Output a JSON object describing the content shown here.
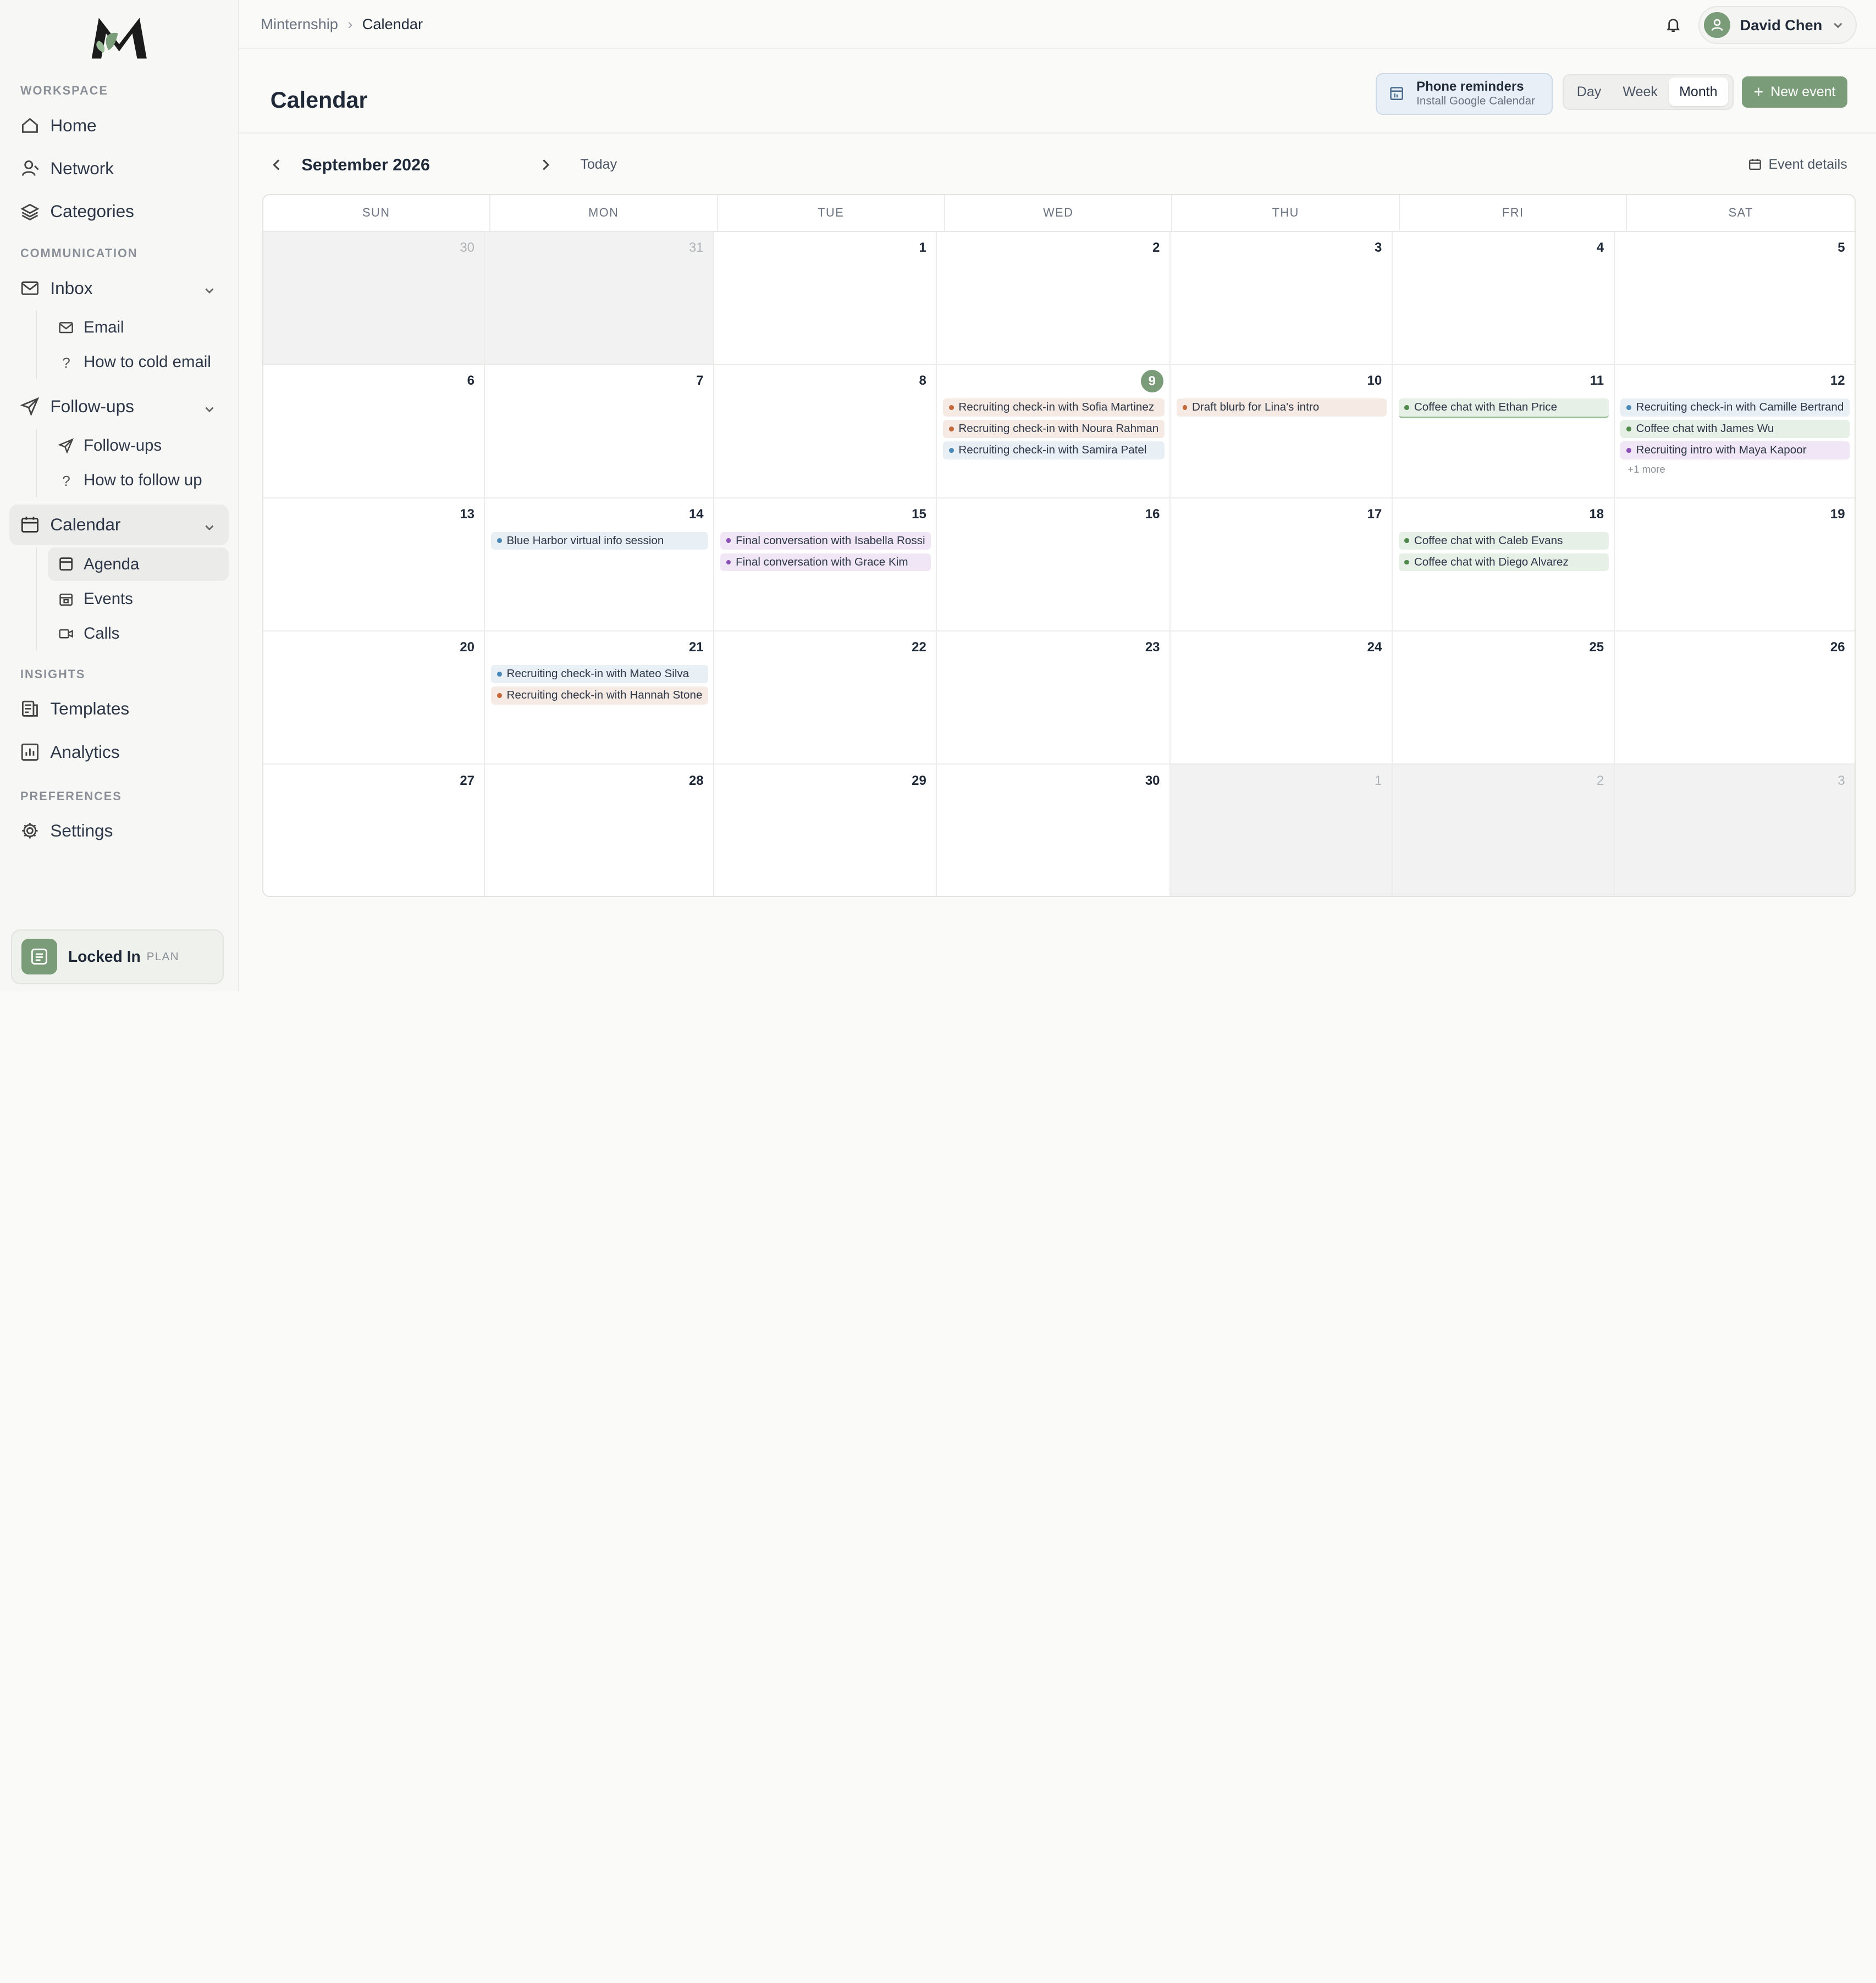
{
  "sidebar": {
    "sections": {
      "workspace": "WORKSPACE",
      "communication": "COMMUNICATION",
      "insights": "INSIGHTS",
      "preferences": "PREFERENCES"
    },
    "home": "Home",
    "network": "Network",
    "categories": "Categories",
    "inbox": "Inbox",
    "email": "Email",
    "how_to_cold_email": "How to cold email",
    "followups": "Follow-ups",
    "followups_sub": "Follow-ups",
    "how_to_follow_up": "How to follow up",
    "calendar": "Calendar",
    "agenda": "Agenda",
    "events": "Events",
    "calls": "Calls",
    "templates": "Templates",
    "analytics": "Analytics",
    "settings": "Settings",
    "plan": {
      "name": "Locked In",
      "tag": "PLAN"
    }
  },
  "topbar": {
    "breadcrumb_root": "Minternship",
    "breadcrumb_current": "Calendar",
    "user_name": "David Chen"
  },
  "header": {
    "title": "Calendar",
    "phone_reminders_title": "Phone reminders",
    "phone_reminders_sub": "Install Google Calendar",
    "views": [
      "Day",
      "Week",
      "Month"
    ],
    "active_view": "Month",
    "new_event": "New event"
  },
  "calendar_nav": {
    "month_label": "September 2026",
    "today": "Today",
    "event_details": "Event details"
  },
  "calendar": {
    "weekdays": [
      "SUN",
      "MON",
      "TUE",
      "WED",
      "THU",
      "FRI",
      "SAT"
    ],
    "today_date": "9",
    "weeks": [
      [
        {
          "day": "30",
          "out": true,
          "events": []
        },
        {
          "day": "31",
          "out": true,
          "events": []
        },
        {
          "day": "1",
          "events": []
        },
        {
          "day": "2",
          "events": []
        },
        {
          "day": "3",
          "events": []
        },
        {
          "day": "4",
          "events": []
        },
        {
          "day": "5",
          "events": []
        }
      ],
      [
        {
          "day": "6",
          "events": []
        },
        {
          "day": "7",
          "events": []
        },
        {
          "day": "8",
          "events": []
        },
        {
          "day": "9",
          "today": true,
          "events": [
            {
              "title": "Recruiting check-in with Sofia Martinez",
              "color": "orange"
            },
            {
              "title": "Recruiting check-in with Noura Rahman",
              "color": "orange"
            },
            {
              "title": "Recruiting check-in with Samira Patel",
              "color": "blue"
            }
          ]
        },
        {
          "day": "10",
          "events": [
            {
              "title": "Draft blurb for Lina's intro",
              "color": "orange"
            }
          ]
        },
        {
          "day": "11",
          "events": [
            {
              "title": "Coffee chat with Ethan Price",
              "color": "green-b"
            }
          ]
        },
        {
          "day": "12",
          "events": [
            {
              "title": "Recruiting check-in with Camille Bertrand",
              "color": "blue"
            },
            {
              "title": "Coffee chat with James Wu",
              "color": "green"
            },
            {
              "title": "Recruiting intro with Maya Kapoor",
              "color": "purple"
            }
          ],
          "more": "+1 more"
        }
      ],
      [
        {
          "day": "13",
          "events": []
        },
        {
          "day": "14",
          "events": [
            {
              "title": "Blue Harbor virtual info session",
              "color": "blue"
            }
          ]
        },
        {
          "day": "15",
          "events": [
            {
              "title": "Final conversation with Isabella Rossi",
              "color": "purple"
            },
            {
              "title": "Final conversation with Grace Kim",
              "color": "purple"
            }
          ]
        },
        {
          "day": "16",
          "events": []
        },
        {
          "day": "17",
          "events": []
        },
        {
          "day": "18",
          "events": [
            {
              "title": "Coffee chat with Caleb Evans",
              "color": "green"
            },
            {
              "title": "Coffee chat with Diego Alvarez",
              "color": "green"
            }
          ]
        },
        {
          "day": "19",
          "events": []
        }
      ],
      [
        {
          "day": "20",
          "events": []
        },
        {
          "day": "21",
          "events": [
            {
              "title": "Recruiting check-in with Mateo Silva",
              "color": "blue"
            },
            {
              "title": "Recruiting check-in with Hannah Stone",
              "color": "orange"
            }
          ]
        },
        {
          "day": "22",
          "events": []
        },
        {
          "day": "23",
          "events": []
        },
        {
          "day": "24",
          "events": []
        },
        {
          "day": "25",
          "events": []
        },
        {
          "day": "26",
          "events": []
        }
      ],
      [
        {
          "day": "27",
          "events": []
        },
        {
          "day": "28",
          "events": []
        },
        {
          "day": "29",
          "events": []
        },
        {
          "day": "30",
          "events": []
        },
        {
          "day": "1",
          "out": true,
          "events": []
        },
        {
          "day": "2",
          "out": true,
          "events": []
        },
        {
          "day": "3",
          "out": true,
          "events": []
        }
      ]
    ]
  },
  "colors": {
    "accent": "#7a9c78",
    "event_orange": "#c2683a",
    "event_blue": "#4b8ab8",
    "event_green": "#4f8a4c",
    "event_purple": "#8c4fb8"
  }
}
